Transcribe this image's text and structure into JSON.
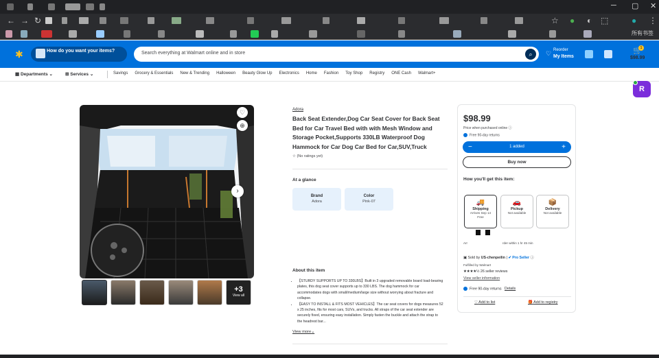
{
  "header": {
    "pickup_label": "How do you want your items?",
    "search_placeholder": "Search everything at Walmart online and in store",
    "reorder_line1": "Reorder",
    "reorder_line2": "My Items",
    "cart_count": "1",
    "cart_total": "$98.99"
  },
  "browser": {
    "bookmarks_folder": "所有书签"
  },
  "nav": {
    "departments": "Departments",
    "services": "Services",
    "links": [
      "Savings",
      "Grocery & Essentials",
      "New & Trending",
      "Halloween",
      "Beauty Glow Up",
      "Electronics",
      "Home",
      "Fashion",
      "Toy Shop",
      "Registry",
      "ONE Cash",
      "Walmart+"
    ]
  },
  "gallery": {
    "more_count": "+3",
    "view_all": "View all"
  },
  "product": {
    "brand": "Adora",
    "title": "Back Seat Extender,Dog Car Seat Cover for Back Seat Bed for Car Travel Bed with with Mesh Window and Storage Pocket,Supports 330LB Waterproof Dog Hammock for Car Dog Car Bed for Car,SUV,Truck",
    "ratings": "(No ratings yet)",
    "glance_heading": "At a glance",
    "glance": [
      {
        "key": "Brand",
        "value": "Adora"
      },
      {
        "key": "Color",
        "value": "Pink-07"
      }
    ],
    "about_heading": "About this item",
    "about": [
      "【STURDY SUPPORTS UP TO 330LBS】Built in 3 upgraded removable board load-bearing plates, this dog seat cover supports up to 330 LBS. The dog hammock for car accommodates dogs with small/medium/large size without worrying about fracture and collapse.",
      "【EASY TO INSTALL & FITS MOST VEHICLES】The car seat covers for dogs measures 52 x 25 inches, fits for most cars, SUVs, and trucks. All straps of the car seat extender are securely fixed, ensuring easy installation. Simply fasten the buckle and attach the strap to the headrest bar..."
    ],
    "view_more": "View more"
  },
  "buybox": {
    "price": "$98.99",
    "price_note": "Price when purchased online",
    "free_returns": "Free 90-day returns",
    "added_label": "1 added",
    "buy_now": "Buy now",
    "how_heading": "How you'll get this item:",
    "options": [
      {
        "title": "Shipping",
        "line1": "Arrives Sep 14",
        "line2": "Free"
      },
      {
        "title": "Pickup",
        "line1": "Not available",
        "line2": ""
      },
      {
        "title": "Delivery",
        "line1": "Not available",
        "line2": ""
      }
    ],
    "arrival_prefix": "Arr",
    "arrival_suffix": "rder within 1 hr 45 min",
    "sold_by_label": "Sold by",
    "seller": "US-chenpeilin",
    "pro_seller": "Pro Seller",
    "fulfilled": "Fulfilled by Walmart",
    "seller_reviews": "26 seller reviews",
    "view_seller": "View seller information",
    "free90": "Free 90-day returns",
    "details": "Details",
    "add_list": "Add to list",
    "add_registry": "Add to registry"
  },
  "extension": {
    "letter": "R"
  },
  "colors": {
    "walmart_blue": "#0071dc",
    "spark_yellow": "#ffc220",
    "navy": "#002d58",
    "glance_bg": "#e6f1fc",
    "extension_purple": "#7b2ddb"
  }
}
